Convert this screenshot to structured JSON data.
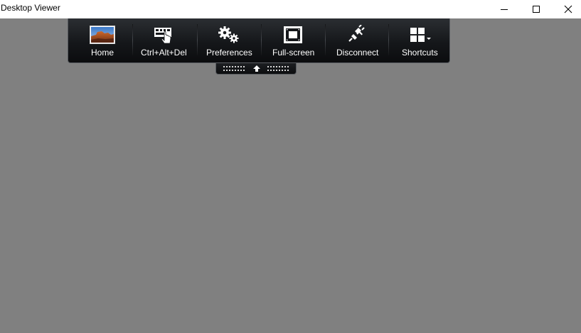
{
  "window": {
    "title": "Desktop Viewer",
    "controls": {
      "minimize_icon": "minimize-icon",
      "maximize_icon": "maximize-icon",
      "close_icon": "close-icon"
    },
    "background_color": "#808080"
  },
  "toolbar": {
    "items": [
      {
        "id": "home",
        "label": "Home",
        "icon": "landscape-photo-icon"
      },
      {
        "id": "ctrl-alt-del",
        "label": "Ctrl+Alt+Del",
        "icon": "keyboard-hand-icon"
      },
      {
        "id": "preferences",
        "label": "Preferences",
        "icon": "gears-icon"
      },
      {
        "id": "full-screen",
        "label": "Full-screen",
        "icon": "fullscreen-icon"
      },
      {
        "id": "disconnect",
        "label": "Disconnect",
        "icon": "plug-icon"
      },
      {
        "id": "shortcuts",
        "label": "Shortcuts",
        "icon": "grid-dropdown-icon"
      }
    ],
    "collapse_handle_icon": "arrow-up-icon"
  }
}
